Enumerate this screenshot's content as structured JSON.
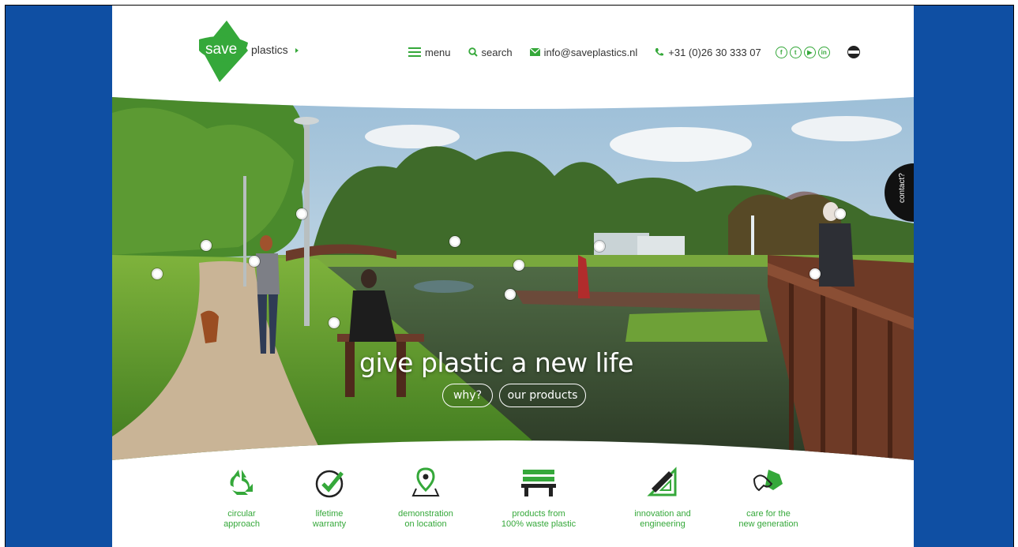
{
  "brand": {
    "logo_save": "save",
    "logo_plastics": "plastics",
    "accent_color": "#35a83a",
    "side_color": "#0f4fa3"
  },
  "nav": {
    "menu": "menu",
    "search": "search",
    "email": "info@saveplastics.nl",
    "phone": "+31 (0)26 30 333 07",
    "social_icons": [
      "facebook-icon",
      "twitter-icon",
      "youtube-icon",
      "linkedin-icon"
    ],
    "language_icon": "dutch-flag-icon"
  },
  "hero": {
    "tagline": "give plastic a new life",
    "why_button": "why?",
    "products_button": "our products",
    "contact_tab": "contact?"
  },
  "features": [
    {
      "icon": "recycle-icon",
      "label": "circular\napproach"
    },
    {
      "icon": "check-badge-icon",
      "label": "lifetime\nwarranty"
    },
    {
      "icon": "location-pin-icon",
      "label": "demonstration\non location"
    },
    {
      "icon": "bench-icon",
      "label": "products from\n100% waste plastic"
    },
    {
      "icon": "ruler-triangle-icon",
      "label": "innovation and\nengineering"
    },
    {
      "icon": "helping-hands-icon",
      "label": "care for the\nnew generation"
    }
  ]
}
